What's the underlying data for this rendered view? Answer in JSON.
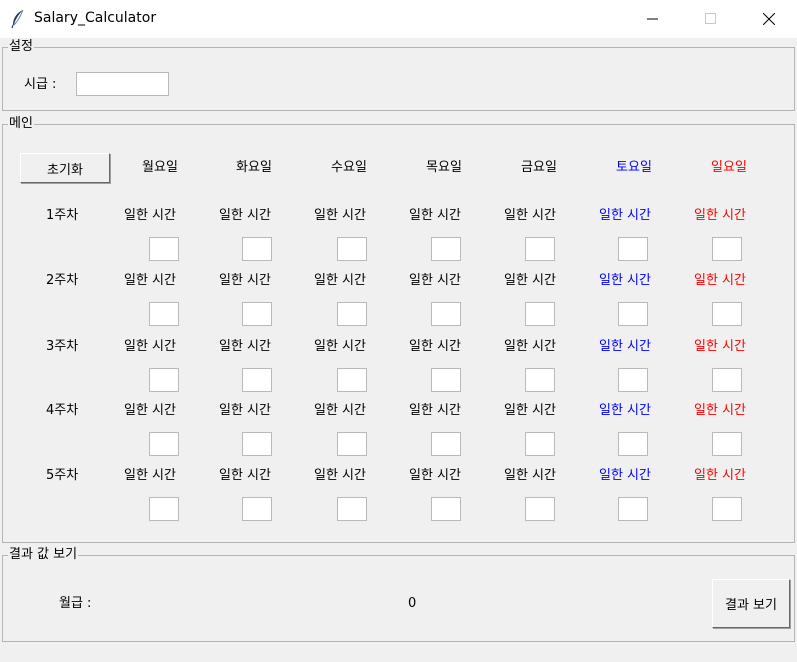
{
  "window": {
    "title": "Salary_Calculator"
  },
  "settings": {
    "legend": "설정",
    "wage_label": "시급 :",
    "wage_value": ""
  },
  "main": {
    "legend": "메인",
    "reset_label": "초기화",
    "days": [
      {
        "label": "월요일",
        "color": "#000000"
      },
      {
        "label": "화요일",
        "color": "#000000"
      },
      {
        "label": "수요일",
        "color": "#000000"
      },
      {
        "label": "목요일",
        "color": "#000000"
      },
      {
        "label": "금요일",
        "color": "#000000"
      },
      {
        "label": "토요일",
        "color": "#0000ff"
      },
      {
        "label": "일요일",
        "color": "#ff0000"
      }
    ],
    "hours_label": "일한 시간",
    "weeks": [
      "1주차",
      "2주차",
      "3주차",
      "4주차",
      "5주차"
    ]
  },
  "result": {
    "legend": "결과 값 보기",
    "salary_label": "월급 :",
    "salary_value": "0",
    "show_button": "결과 보기"
  }
}
